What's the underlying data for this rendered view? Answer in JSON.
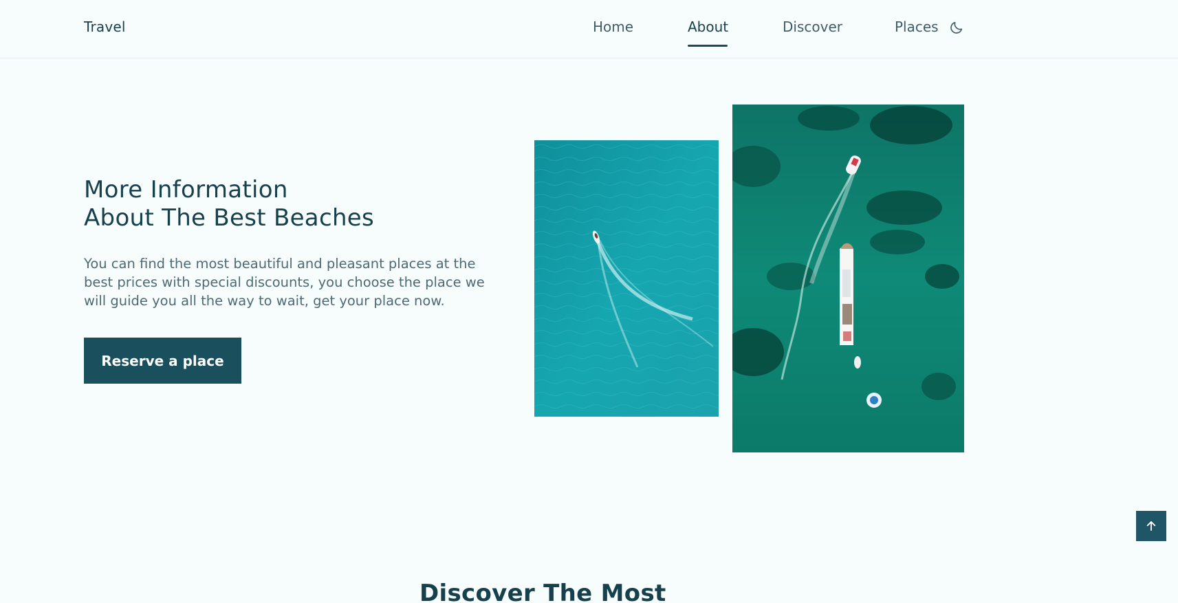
{
  "header": {
    "logo": "Travel",
    "nav": {
      "home": "Home",
      "about": "About",
      "discover": "Discover",
      "places": "Places"
    },
    "active_item": "About",
    "theme_toggle_icon": "moon-icon"
  },
  "hero": {
    "title_line1": "More Information",
    "title_line2": "About The Best Beaches",
    "description": "You can find the most beautiful and pleasant places at the best prices with special discounts, you choose the place we will guide you all the way to wait, get your place now.",
    "cta_label": "Reserve a place"
  },
  "images": {
    "left": "aerial-boat-turquoise-sea-photo",
    "right": "aerial-yacht-green-sea-photo"
  },
  "scroll_top_icon": "arrow-up-icon",
  "next_section": {
    "title": "Discover The Most"
  },
  "colors": {
    "background": "#f7fdfd",
    "primary": "#1a4f5e",
    "heading": "#17404d",
    "text": "#4d6a72"
  }
}
